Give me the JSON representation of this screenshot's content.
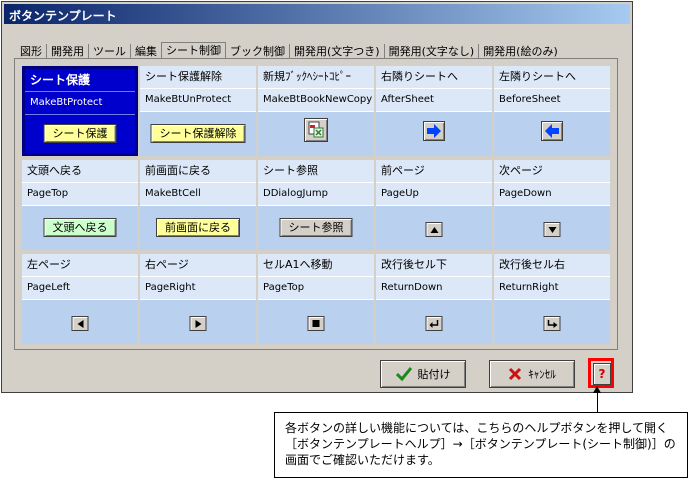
{
  "window": {
    "title": "ボタンテンプレート"
  },
  "tabs": [
    "図形",
    "開発用",
    "ツール",
    "編集",
    "シート制御",
    "ブック制御",
    "開発用(文字つき)",
    "開発用(文字なし)",
    "開発用(絵のみ)"
  ],
  "active_tab": "シート制御",
  "cells": [
    {
      "label": "シート保護",
      "code": "MakeBtProtect",
      "button": "シート保護"
    },
    {
      "label": "シート保護解除",
      "code": "MakeBtUnProtect",
      "button": "シート保護解除"
    },
    {
      "label": "新規ﾌﾞｯｸﾍｼｰﾄｺﾋﾟｰ",
      "code": "MakeBtBookNewCopy",
      "icon": "copy-sheet-icon"
    },
    {
      "label": "右隣りシートへ",
      "code": "AfterSheet",
      "icon": "arrow-right-icon"
    },
    {
      "label": "左隣りシートへ",
      "code": "BeforeSheet",
      "icon": "arrow-left-icon"
    },
    {
      "label": "文頭へ戻る",
      "code": "PageTop",
      "button": "文頭へ戻る"
    },
    {
      "label": "前画面に戻る",
      "code": "MakeBtCell",
      "button": "前画面に戻る"
    },
    {
      "label": "シート参照",
      "code": "DDialogJump",
      "button": "シート参照"
    },
    {
      "label": "前ページ",
      "code": "PageUp",
      "icon": "triangle-up-icon"
    },
    {
      "label": "次ページ",
      "code": "PageDown",
      "icon": "triangle-down-icon"
    },
    {
      "label": "左ページ",
      "code": "PageLeft",
      "icon": "triangle-left-icon"
    },
    {
      "label": "右ページ",
      "code": "PageRight",
      "icon": "triangle-right-icon"
    },
    {
      "label": "セルA1へ移動",
      "code": "PageTop",
      "icon": "square-stop-icon"
    },
    {
      "label": "改行後セル下",
      "code": "ReturnDown",
      "icon": "return-down-icon"
    },
    {
      "label": "改行後セル右",
      "code": "ReturnRight",
      "icon": "return-right-icon"
    }
  ],
  "footer": {
    "paste": "貼付け",
    "cancel": "ｷｬﾝｾﾙ",
    "help": "?"
  },
  "callout": {
    "text": "各ボタンの詳しい機能については、こちらのヘルプボタンを押して開く［ボタンテンプレートヘルプ］→［ボタンテンプレート(シート制御)］の画面でご確認いただけます。"
  },
  "colors": {
    "selected": "#0000cc",
    "cell": "#b9d1ee",
    "accent_arrow": "#0044ff",
    "help_border": "#ff0000"
  }
}
